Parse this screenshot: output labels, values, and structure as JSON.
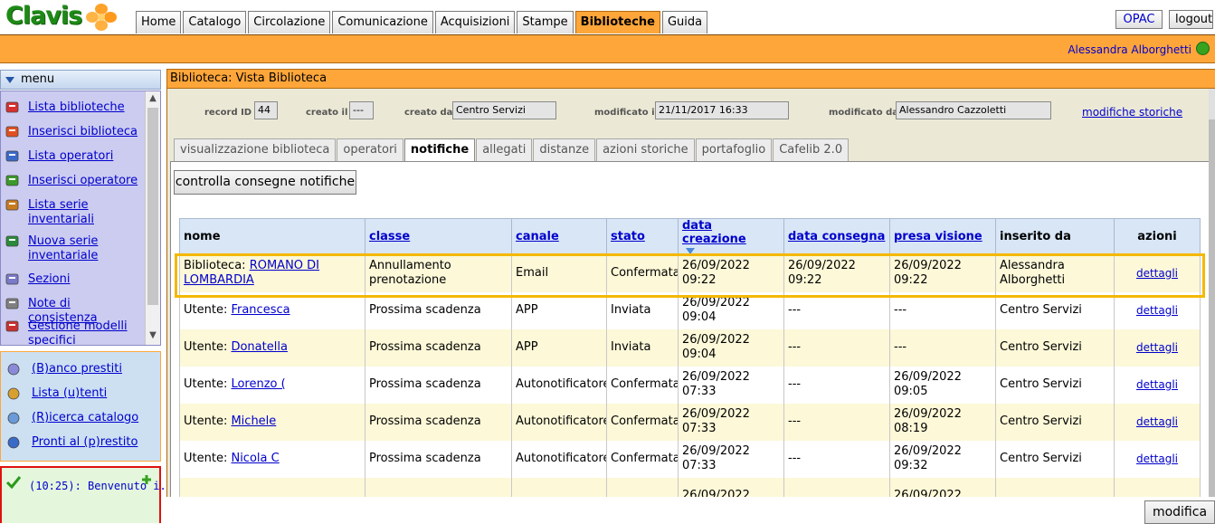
{
  "app": {
    "logo_text": "Clavis",
    "user_name": "Alessandra Alborghetti"
  },
  "nav": {
    "tabs": [
      "Home",
      "Catalogo",
      "Circolazione",
      "Comunicazione",
      "Acquisizioni",
      "Stampe",
      "Biblioteche",
      "Guida"
    ],
    "active_tab": "Biblioteche",
    "opac": "OPAC",
    "logout": "logout"
  },
  "sidebar": {
    "menu_title": "menu",
    "items": [
      {
        "label": "Lista biblioteche",
        "icon": "library-list-icon"
      },
      {
        "label": "Inserisci biblioteca",
        "icon": "add-library-icon"
      },
      {
        "label": "Lista operatori",
        "icon": "operators-icon"
      },
      {
        "label": "Inserisci operatore",
        "icon": "add-operator-icon"
      },
      {
        "label": "Lista serie inventariali",
        "icon": "inventory-list-icon"
      },
      {
        "label": "Nuova serie inventariale",
        "icon": "new-inventory-icon"
      },
      {
        "label": "Sezioni",
        "icon": "sections-icon"
      },
      {
        "label": "Note di consistenza",
        "icon": "notes-icon"
      },
      {
        "label": "Gestione modelli specifici",
        "icon": "templates-icon"
      }
    ],
    "quick": [
      {
        "label": "(B)anco prestiti",
        "icon": "loan-desk-icon"
      },
      {
        "label": "Lista (u)tenti",
        "icon": "users-icon"
      },
      {
        "label": "(R)icerca catalogo",
        "icon": "search-catalog-icon"
      },
      {
        "label": "Pronti al (p)restito",
        "icon": "ready-loan-icon"
      }
    ],
    "message": "(10:25): Benvenuto i.."
  },
  "main": {
    "title": "Biblioteca: Vista Biblioteca",
    "record": {
      "record_id_label": "record ID",
      "record_id": "44",
      "created_label": "creato il",
      "created": "---",
      "created_by_label": "creato da",
      "created_by": "Centro Servizi",
      "modified_label": "modificato il",
      "modified": "21/11/2017 16:33",
      "modified_by_label": "modificato da",
      "modified_by": "Alessandro Cazzoletti",
      "history_link": "modifiche storiche"
    },
    "subtabs": [
      "visualizzazione biblioteca",
      "operatori",
      "notifiche",
      "allegati",
      "distanze",
      "azioni storiche",
      "portafoglio",
      "Cafelib 2.0"
    ],
    "active_subtab": "notifiche",
    "check_button": "controlla consegne notifiche",
    "table": {
      "headers": [
        "nome",
        "classe",
        "canale",
        "stato",
        "data creazione",
        "data consegna",
        "presa visione",
        "inserito da",
        "azioni"
      ],
      "rows": [
        {
          "prefix": "Biblioteca:",
          "name": "ROMANO DI LOMBARDIA",
          "class": "Annullamento prenotazione",
          "channel": "Email",
          "state": "Confermata",
          "created": "26/09/2022 09:22",
          "delivered": "26/09/2022 09:22",
          "seen": "26/09/2022 09:22",
          "by": "Alessandra Alborghetti",
          "action": "dettagli"
        },
        {
          "prefix": "Utente:",
          "name": "Francesca",
          "class": "Prossima scadenza",
          "channel": "APP",
          "state": "Inviata",
          "created": "26/09/2022 09:04",
          "delivered": "---",
          "seen": "---",
          "by": "Centro Servizi",
          "action": "dettagli"
        },
        {
          "prefix": "Utente:",
          "name": "Donatella",
          "class": "Prossima scadenza",
          "channel": "APP",
          "state": "Inviata",
          "created": "26/09/2022 09:04",
          "delivered": "---",
          "seen": "---",
          "by": "Centro Servizi",
          "action": "dettagli"
        },
        {
          "prefix": "Utente:",
          "name": "Lorenzo (",
          "class": "Prossima scadenza",
          "channel": "Autonotificatore",
          "state": "Confermata",
          "created": "26/09/2022 07:33",
          "delivered": "---",
          "seen": "26/09/2022 09:05",
          "by": "Centro Servizi",
          "action": "dettagli"
        },
        {
          "prefix": "Utente:",
          "name": "Michele",
          "class": "Prossima scadenza",
          "channel": "Autonotificatore",
          "state": "Confermata",
          "created": "26/09/2022 07:33",
          "delivered": "---",
          "seen": "26/09/2022 08:19",
          "by": "Centro Servizi",
          "action": "dettagli"
        },
        {
          "prefix": "Utente:",
          "name": "Nicola C",
          "class": "Prossima scadenza",
          "channel": "Autonotificatore",
          "state": "Confermata",
          "created": "26/09/2022 07:33",
          "delivered": "---",
          "seen": "26/09/2022 09:32",
          "by": "Centro Servizi",
          "action": "dettagli"
        },
        {
          "prefix": "",
          "name": "",
          "class": "",
          "channel": "",
          "state": "",
          "created": "26/09/2022",
          "delivered": "",
          "seen": "26/09/2022",
          "by": "",
          "action": ""
        }
      ]
    },
    "modify_button": "modifica"
  },
  "colors": {
    "orange": "#ffa63a",
    "link": "#0000cc",
    "highlight": "#f5b800"
  }
}
